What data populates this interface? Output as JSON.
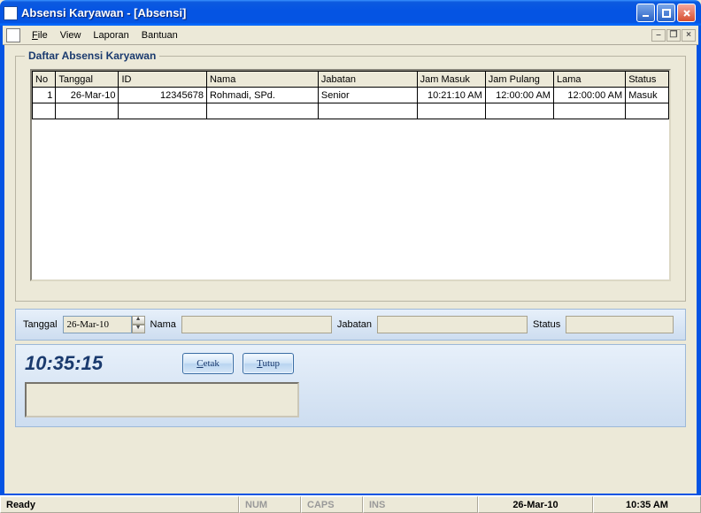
{
  "window": {
    "title": "Absensi Karyawan - [Absensi]"
  },
  "menu": {
    "file": "File",
    "view": "View",
    "laporan": "Laporan",
    "bantuan": "Bantuan"
  },
  "group": {
    "legend": "Daftar Absensi Karyawan"
  },
  "table": {
    "headers": {
      "no": "No",
      "tanggal": "Tanggal",
      "id": "ID",
      "nama": "Nama",
      "jabatan": "Jabatan",
      "jam_masuk": "Jam Masuk",
      "jam_pulang": "Jam Pulang",
      "lama": "Lama",
      "status": "Status"
    },
    "rows": [
      {
        "no": "1",
        "tanggal": "26-Mar-10",
        "id": "12345678",
        "nama": "Rohmadi, SPd.",
        "jabatan": "Senior",
        "jam_masuk": "10:21:10 AM",
        "jam_pulang": "12:00:00 AM",
        "lama": "12:00:00 AM",
        "status": "Masuk"
      }
    ]
  },
  "filter": {
    "tanggal_label": "Tanggal",
    "tanggal_value": "26-Mar-10",
    "nama_label": "Nama",
    "nama_value": "",
    "jabatan_label": "Jabatan",
    "jabatan_value": "",
    "status_label": "Status",
    "status_value": ""
  },
  "actions": {
    "clock": "10:35:15",
    "cetak": "Cetak",
    "tutup": "Tutup"
  },
  "statusbar": {
    "ready": "Ready",
    "num": "NUM",
    "caps": "CAPS",
    "ins": "INS",
    "date": "26-Mar-10",
    "time": "10:35 AM"
  }
}
